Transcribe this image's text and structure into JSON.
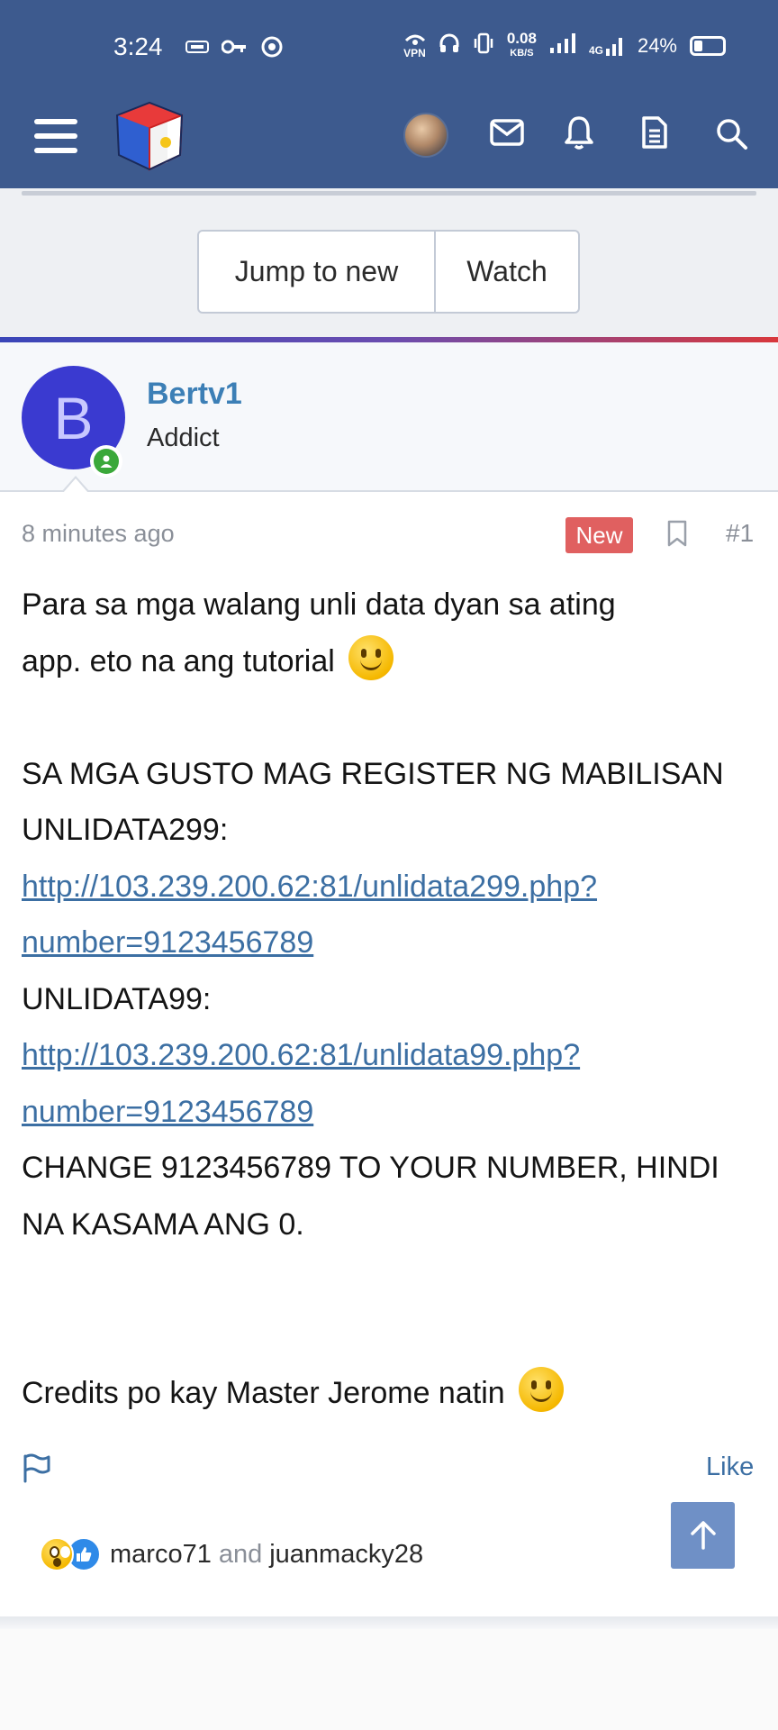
{
  "status_bar": {
    "time": "3:24",
    "vpn_label": "VPN",
    "speed_value": "0.08",
    "speed_unit": "KB/S",
    "network": "4G",
    "battery": "24%"
  },
  "header": {
    "icons": [
      "menu-icon",
      "site-logo",
      "avatar",
      "mail-icon",
      "bell-icon",
      "document-icon",
      "search-icon"
    ],
    "brand_colors": {
      "header_bg": "#3d5a8e",
      "accent_start": "#3a46b8",
      "accent_end": "#d8383c"
    }
  },
  "thread_actions": {
    "jump_label": "Jump to new",
    "watch_label": "Watch"
  },
  "author": {
    "initial": "B",
    "name": "Bertv1",
    "title": "Addict"
  },
  "post_meta": {
    "time": "8 minutes ago",
    "badge": "New",
    "number": "#1"
  },
  "post_body": {
    "l1": "Para sa mga walang unli data dyan sa ating",
    "l2": "app. eto na ang tutorial",
    "l4": "SA MGA GUSTO MAG REGISTER NG MABILISAN",
    "l5": "UNLIDATA299:",
    "link1a": "http://103.239.200.62:81/unlidata299.php?",
    "link1b": "number=9123456789",
    "l8": "UNLIDATA99:",
    "link2a": "http://103.239.200.62:81/unlidata99.php?",
    "link2b": "number=9123456789",
    "l11": "CHANGE 9123456789 TO YOUR NUMBER, HINDI",
    "l12": "NA KASAMA ANG 0.",
    "l15": "Credits po kay Master Jerome natin"
  },
  "post_actions": {
    "like_label": "Like"
  },
  "reactions": {
    "user1": "marco71",
    "joiner": "and",
    "user2": "juanmacky28"
  }
}
